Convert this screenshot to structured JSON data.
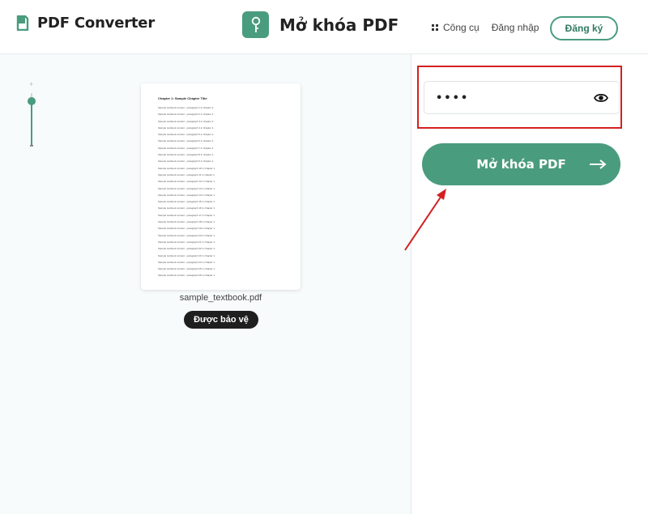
{
  "header": {
    "brand_name": "PDF Converter",
    "tool_title": "Mở khóa PDF",
    "nav_tools": "Công cụ",
    "nav_login": "Đăng nhập",
    "signup_label": "Đăng ký",
    "icons": {
      "brand": "document-icon",
      "tool": "key-icon",
      "tools": "grid-icon"
    }
  },
  "preview": {
    "zoom_icons": [
      "plus-icon",
      "minus-icon"
    ],
    "thumbnail": {
      "heading": "Chapter 1: Sample Chapter Title",
      "lines": [
        "Sample textbook content - paragraph 1 in chapter 1.",
        "Sample textbook content - paragraph 2 in chapter 1.",
        "Sample textbook content - paragraph 3 in chapter 1.",
        "Sample textbook content - paragraph 4 in chapter 1.",
        "Sample textbook content - paragraph 5 in chapter 1.",
        "Sample textbook content - paragraph 6 in chapter 1.",
        "Sample textbook content - paragraph 7 in chapter 1.",
        "Sample textbook content - paragraph 8 in chapter 1.",
        "Sample textbook content - paragraph 9 in chapter 1.",
        "Sample textbook content - paragraph 10 in chapter 1.",
        "Sample textbook content - paragraph 11 in chapter 1.",
        "Sample textbook content - paragraph 12 in chapter 1.",
        "Sample textbook content - paragraph 13 in chapter 1.",
        "Sample textbook content - paragraph 14 in chapter 1.",
        "Sample textbook content - paragraph 15 in chapter 1.",
        "Sample textbook content - paragraph 16 in chapter 1.",
        "Sample textbook content - paragraph 17 in chapter 1.",
        "Sample textbook content - paragraph 18 in chapter 1.",
        "Sample textbook content - paragraph 19 in chapter 1.",
        "Sample textbook content - paragraph 20 in chapter 1.",
        "Sample textbook content - paragraph 21 in chapter 1.",
        "Sample textbook content - paragraph 22 in chapter 1.",
        "Sample textbook content - paragraph 23 in chapter 1.",
        "Sample textbook content - paragraph 24 in chapter 1.",
        "Sample textbook content - paragraph 25 in chapter 1.",
        "Sample textbook content - paragraph 26 in chapter 1."
      ]
    },
    "file_name": "sample_textbook.pdf",
    "status_badge": "Được bảo vệ"
  },
  "panel": {
    "password_value": "••••",
    "eye_icon": "eye-icon",
    "unlock_label": "Mở khóa PDF",
    "arrow_icon": "arrow-right-icon"
  },
  "colors": {
    "accent": "#4a9c7e",
    "annotation": "#d42020",
    "badge": "#1f1f1f"
  }
}
